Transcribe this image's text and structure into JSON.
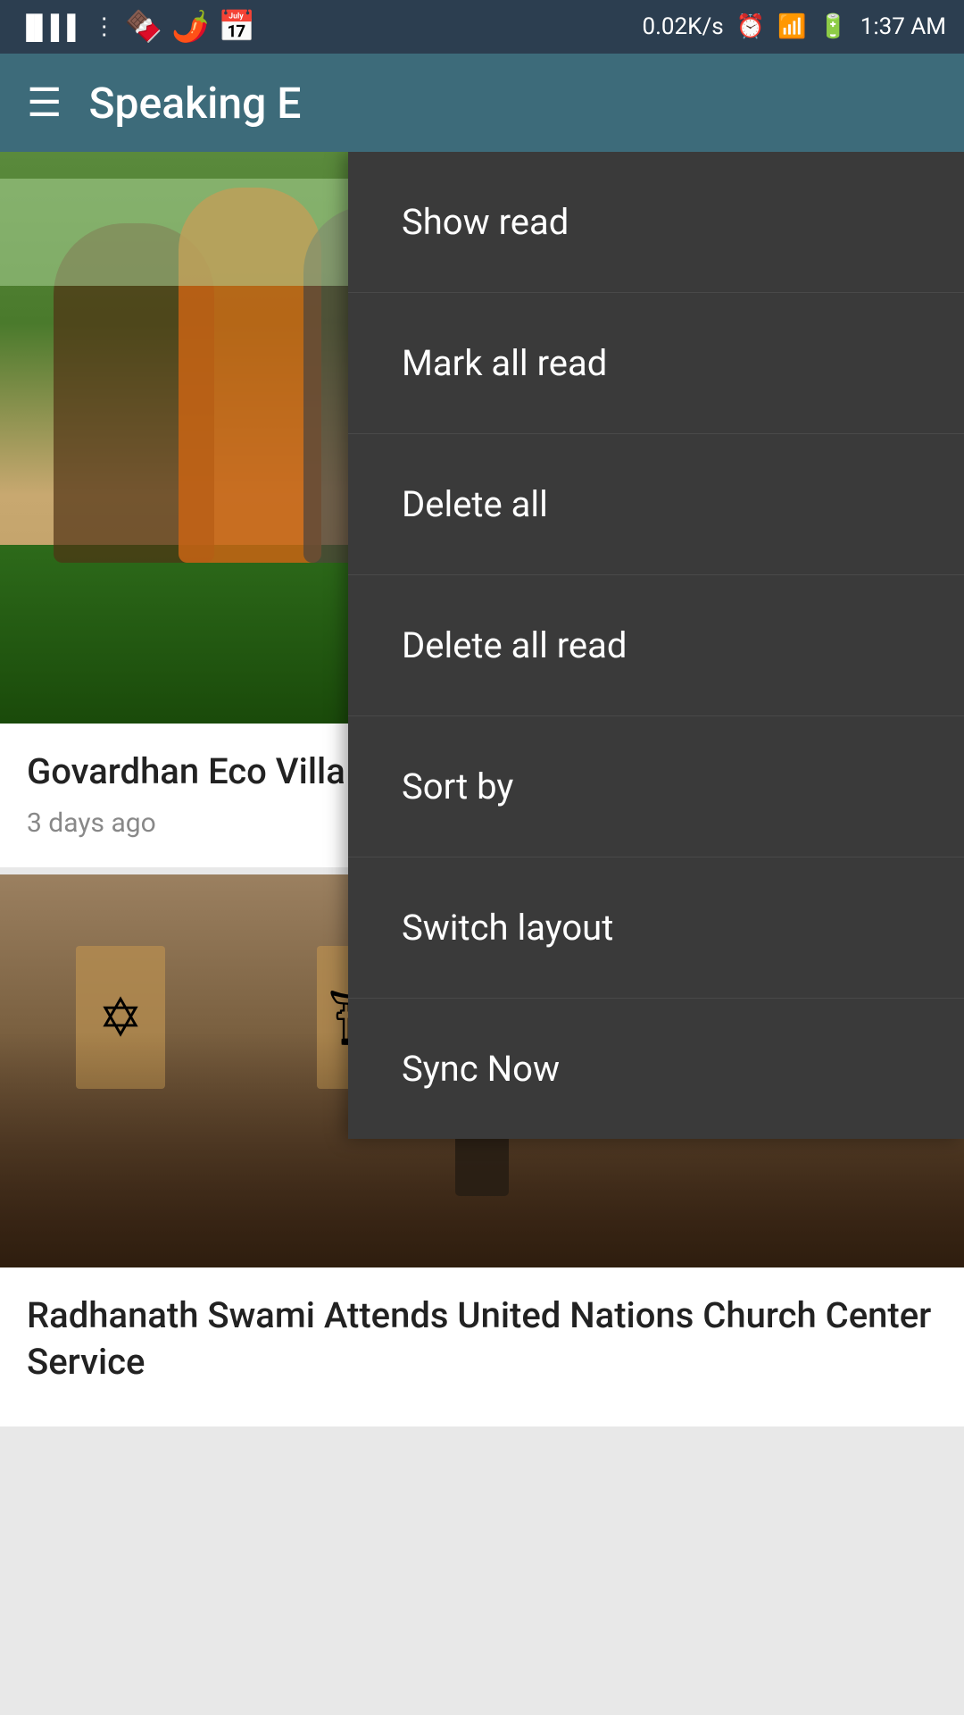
{
  "statusBar": {
    "signal": "▐▐▐▐",
    "network": "0.02K/s",
    "time": "1:37 AM",
    "icons": [
      "clock",
      "wifi",
      "battery"
    ]
  },
  "appBar": {
    "title": "Speaking E",
    "menuIcon": "☰"
  },
  "dropdownMenu": {
    "items": [
      {
        "id": "show-read",
        "label": "Show read"
      },
      {
        "id": "mark-all-read",
        "label": "Mark all read"
      },
      {
        "id": "delete-all",
        "label": "Delete all"
      },
      {
        "id": "delete-all-read",
        "label": "Delete all read"
      },
      {
        "id": "sort-by",
        "label": "Sort by"
      },
      {
        "id": "switch-layout",
        "label": "Switch layout"
      },
      {
        "id": "sync-now",
        "label": "Sync Now"
      }
    ]
  },
  "cards": [
    {
      "id": "card-1",
      "title": "Govardhan Eco Villa Conference",
      "timestamp": "3 days ago"
    },
    {
      "id": "card-2",
      "title": "Radhanath Swami Attends United Nations Church Center Service",
      "timestamp": ""
    }
  ]
}
